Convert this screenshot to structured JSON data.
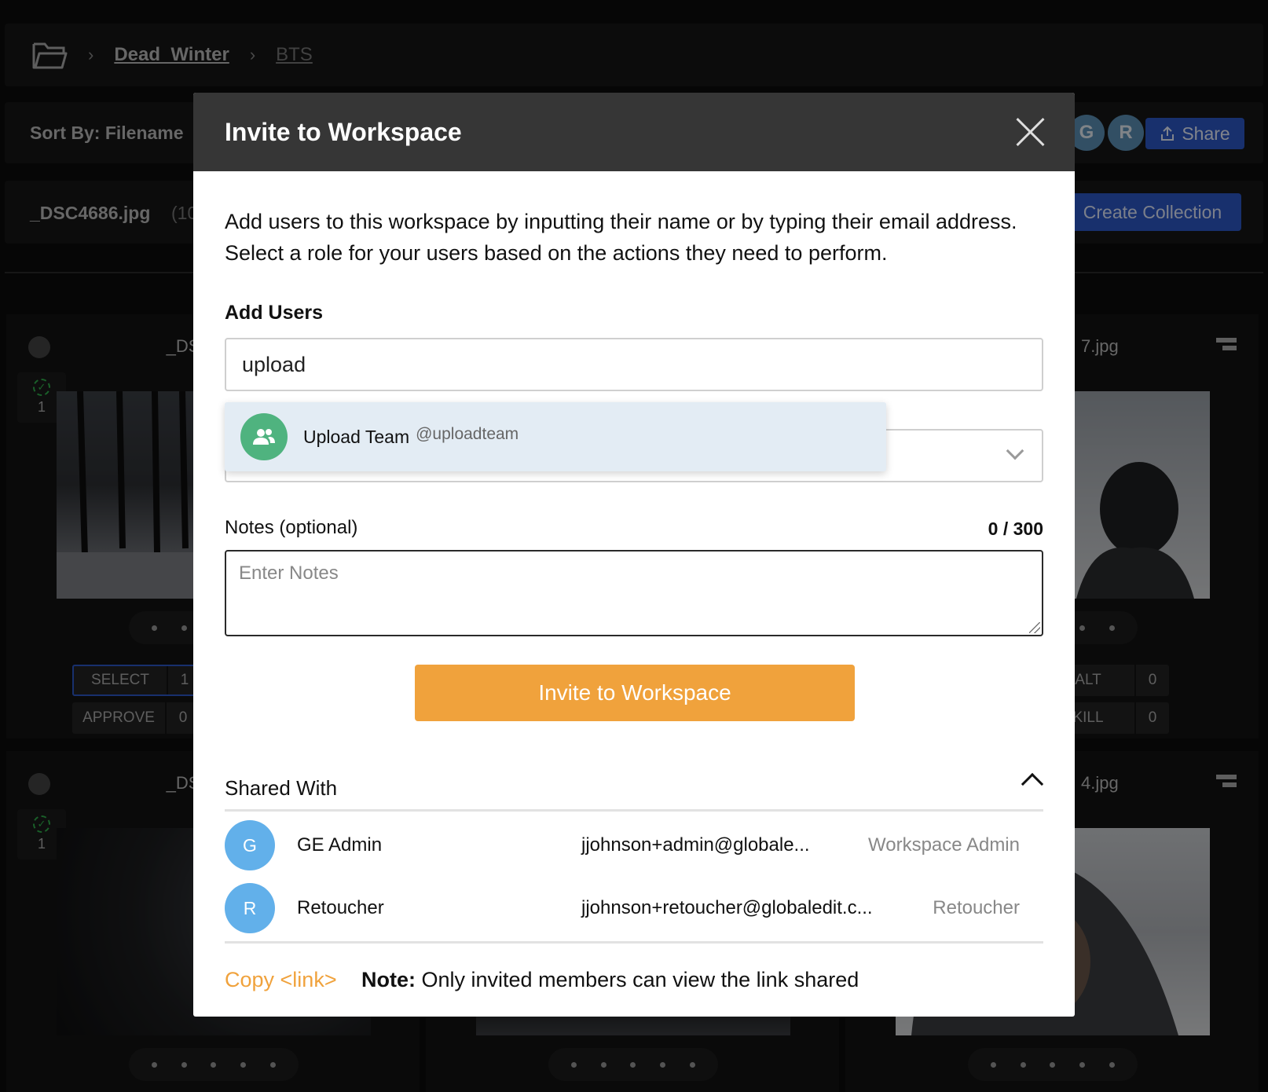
{
  "breadcrumb": {
    "items": [
      "Dead_Winter",
      "BTS"
    ]
  },
  "toolbar": {
    "sort_label": "Sort By: Filename",
    "avatars": [
      "G",
      "R"
    ],
    "share_label": "Share"
  },
  "file_bar": {
    "filename": "_DSC4686.jpg",
    "count_partial": "(10",
    "create_collection_label": "Create Collection"
  },
  "cards": [
    {
      "title_partial": "_DSC",
      "check_count": "1",
      "tags": [
        {
          "label": "SELECT",
          "count": "1"
        },
        {
          "label": "APPROVE",
          "count": "0"
        }
      ]
    },
    {
      "title_partial": "7.jpg",
      "tags": [
        {
          "label": "ALT",
          "count": "0"
        },
        {
          "label": "KILL",
          "count": "0"
        }
      ]
    },
    {
      "title_partial": "_DSC",
      "check_count": "1"
    },
    {
      "title_partial": "4.jpg"
    }
  ],
  "modal": {
    "title": "Invite to Workspace",
    "intro": "Add users to this workspace by inputting their name or by typing their email address. Select a role for your users based on the actions they need to perform.",
    "add_users_label": "Add Users",
    "user_input_value": "upload",
    "suggestion": {
      "name": "Upload Team",
      "handle": "@uploadteam",
      "icon": "users-icon",
      "color": "#4fb37f"
    },
    "notes_label": "Notes (optional)",
    "notes_count": "0 / 300",
    "notes_placeholder": "Enter Notes",
    "invite_button": "Invite to Workspace",
    "shared_with_label": "Shared With",
    "members": [
      {
        "initial": "G",
        "name": "GE Admin",
        "email": "jjohnson+admin@globale...",
        "role": "Workspace Admin"
      },
      {
        "initial": "R",
        "name": "Retoucher",
        "email": "jjohnson+retoucher@globaledit.c...",
        "role": "Retoucher"
      }
    ],
    "copy_link": "Copy <link>",
    "note_bold": "Note:",
    "note_text": " Only invited members can view the link shared"
  },
  "colors": {
    "accent_orange": "#f0a23c",
    "share_blue": "#2b57c7",
    "avatar_blue": "#62b0ea",
    "team_green": "#4fb37f"
  }
}
